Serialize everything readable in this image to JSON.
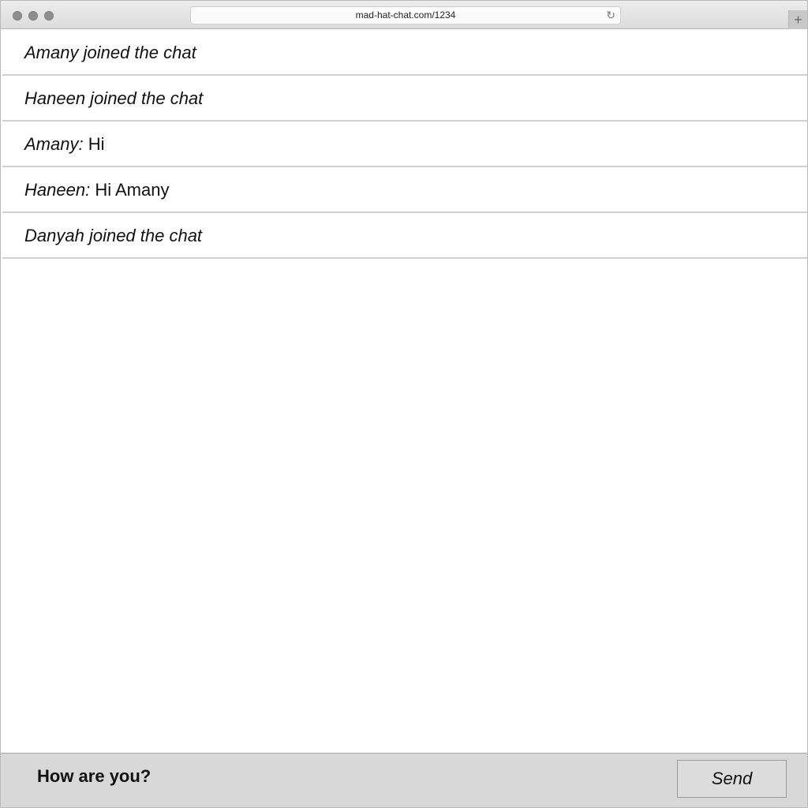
{
  "browser": {
    "url": "mad-hat-chat.com/1234",
    "reload_icon": "reload-icon",
    "new_tab_icon": "plus-icon"
  },
  "chat": {
    "messages": [
      {
        "type": "event",
        "text": "Amany joined the chat"
      },
      {
        "type": "event",
        "text": "Haneen joined the chat"
      },
      {
        "type": "message",
        "sender": "Amany:",
        "text": "Hi"
      },
      {
        "type": "message",
        "sender": "Haneen:",
        "text": "Hi Amany"
      },
      {
        "type": "event",
        "text": "Danyah joined the chat"
      }
    ]
  },
  "composer": {
    "value": "How are you?",
    "send_label": "Send"
  },
  "colors": {
    "divider": "#d0d0d0",
    "composer_bg": "#d8d8d8"
  }
}
